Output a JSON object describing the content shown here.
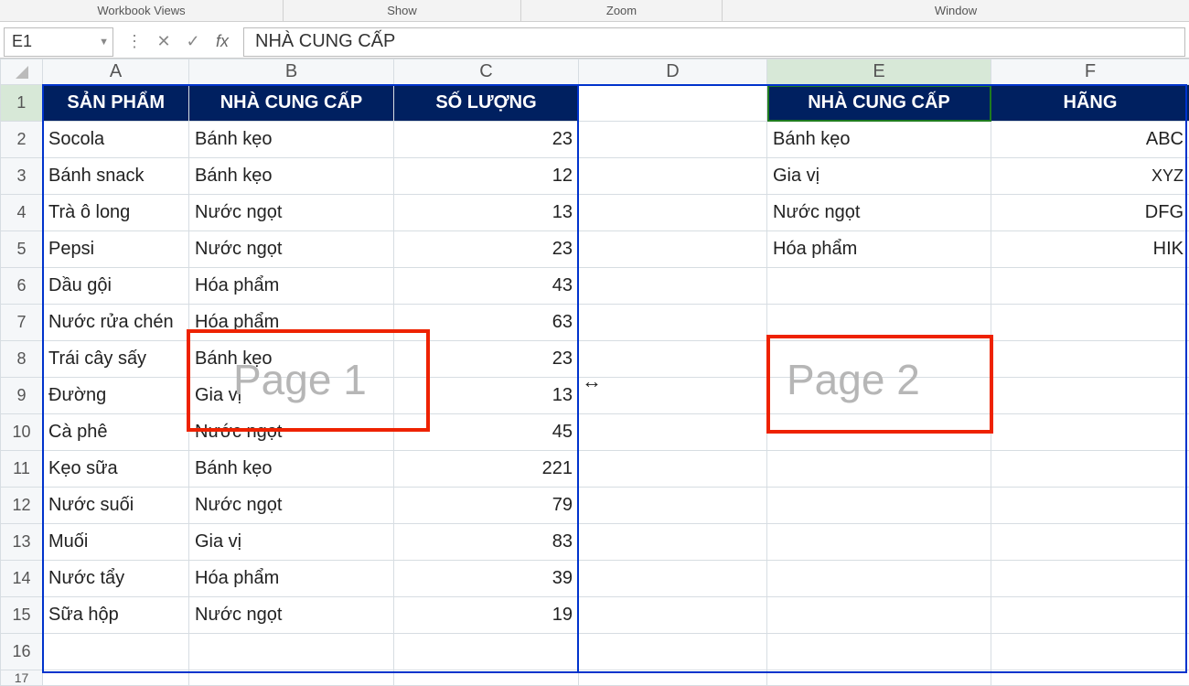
{
  "ribbon_groups": [
    "Workbook Views",
    "Show",
    "Zoom",
    "Window"
  ],
  "name_box": "E1",
  "formula_btns": {
    "dots": "⋮",
    "cancel": "✕",
    "enter": "✓"
  },
  "fx_label": "fx",
  "formula_value": "NHÀ CUNG CẤP",
  "col_headers": [
    "A",
    "B",
    "C",
    "D",
    "E",
    "F"
  ],
  "row_headers": [
    "1",
    "2",
    "3",
    "4",
    "5",
    "6",
    "7",
    "8",
    "9",
    "10",
    "11",
    "12",
    "13",
    "14",
    "15",
    "16",
    "17"
  ],
  "selected_cell": "E1",
  "table1": {
    "headers": [
      "SẢN PHẨM",
      "NHÀ CUNG CẤP",
      "SỐ LƯỢNG"
    ],
    "rows": [
      [
        "Socola",
        "Bánh kẹo",
        23
      ],
      [
        "Bánh snack",
        "Bánh kẹo",
        12
      ],
      [
        "Trà ô long",
        "Nước ngọt",
        13
      ],
      [
        "Pepsi",
        "Nước ngọt",
        23
      ],
      [
        "Dầu gội",
        "Hóa phẩm",
        43
      ],
      [
        "Nước rửa chén",
        "Hóa phẩm",
        63
      ],
      [
        "Trái cây sấy",
        "Bánh kẹo",
        23
      ],
      [
        "Đường",
        "Gia vị",
        13
      ],
      [
        "Cà phê",
        "Nước ngọt",
        45
      ],
      [
        "Kẹo sữa",
        "Bánh kẹo",
        221
      ],
      [
        "Nước suối",
        "Nước ngọt",
        79
      ],
      [
        "Muối",
        "Gia vị",
        83
      ],
      [
        "Nước tẩy",
        "Hóa phẩm",
        39
      ],
      [
        "Sữa hộp",
        "Nước ngọt",
        19
      ]
    ]
  },
  "table2": {
    "headers": [
      "NHÀ CUNG CẤP",
      "HÃNG"
    ],
    "rows": [
      [
        "Bánh kẹo",
        "ABC"
      ],
      [
        "Gia vị",
        "XYZ"
      ],
      [
        "Nước ngọt",
        "DFG"
      ],
      [
        "Hóa phẩm",
        "HIK"
      ]
    ]
  },
  "watermarks": {
    "page1": "Page 1",
    "page2": "Page 2"
  },
  "resize_glyph": "↔"
}
